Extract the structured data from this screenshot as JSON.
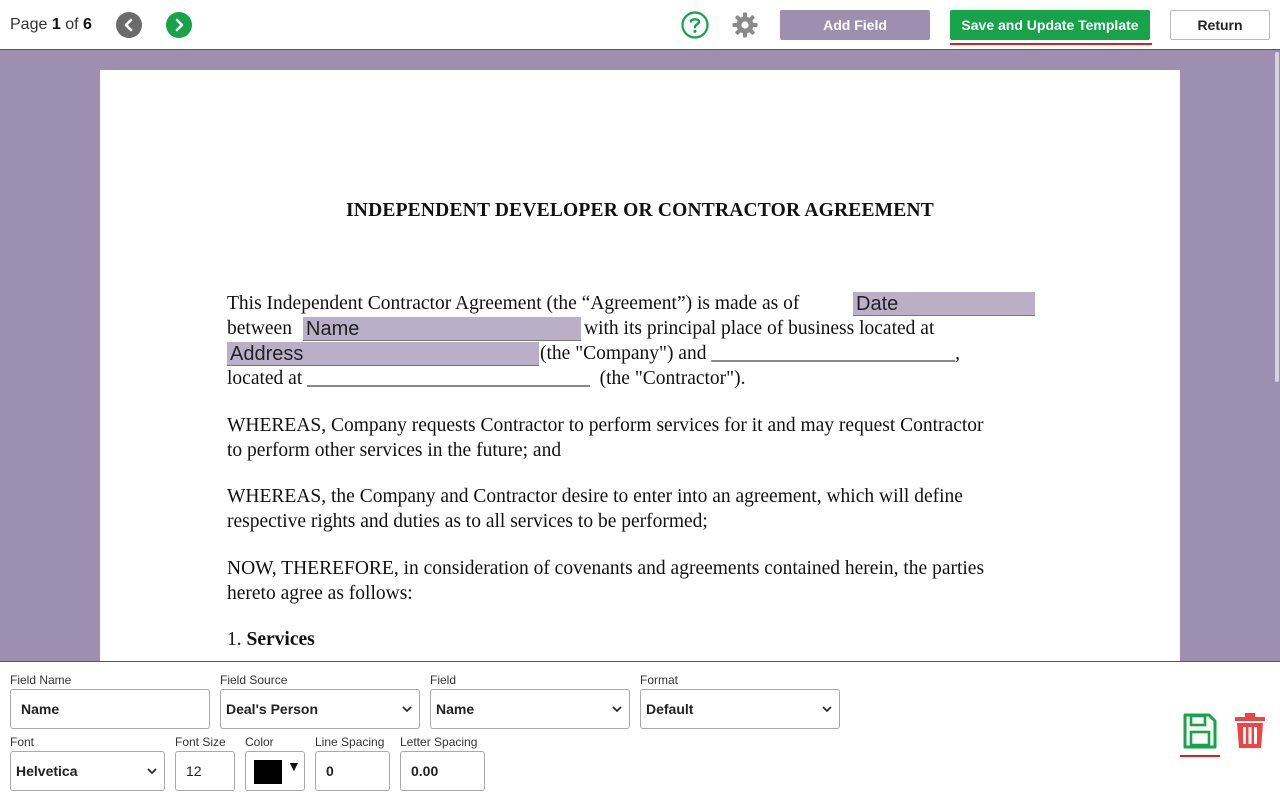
{
  "toolbar": {
    "page_prefix": "Page",
    "page_current": "1",
    "page_of": "of",
    "page_total": "6",
    "add_field_label": "Add Field",
    "save_label": "Save and Update Template",
    "return_label": "Return",
    "icons": [
      "chevron-left-icon",
      "chevron-right-icon",
      "help-icon",
      "gear-icon"
    ]
  },
  "document": {
    "title": "INDEPENDENT DEVELOPER OR CONTRACTOR AGREEMENT",
    "lines": [
      "This Independent Contractor Agreement (the “Agreement”) is made as of",
      "between",
      "with its principal place of business located at",
      "(the \"Company\") and _________________________,",
      "located at _____________________________  (the \"Contractor\").",
      "WHEREAS, Company requests Contractor to perform services for it and may request Contractor",
      "to perform other services in the future; and",
      "WHEREAS, the Company and Contractor desire to enter into an agreement, which will define",
      "respective rights and duties as to all services to be performed;",
      "NOW, THEREFORE, in consideration of covenants and agreements contained herein, the parties",
      "hereto agree as follows:",
      "1."
    ],
    "section_title": "Services",
    "fields": {
      "date": "Date",
      "name": "Name",
      "address": "Address"
    }
  },
  "panel": {
    "field_name_label": "Field Name",
    "field_name_value": "Name",
    "field_source_label": "Field Source",
    "field_source_value": "Deal's Person",
    "field_label": "Field",
    "field_value": "Name",
    "format_label": "Format",
    "format_value": "Default",
    "font_label": "Font",
    "font_value": "Helvetica",
    "font_size_label": "Font Size",
    "font_size_value": "12",
    "color_label": "Color",
    "color_value": "#000000",
    "line_spacing_label": "Line Spacing",
    "line_spacing_value": "0",
    "letter_spacing_label": "Letter Spacing",
    "letter_spacing_value": "0.00"
  },
  "colors": {
    "accent_green": "#16a34a",
    "workspace_bg": "#9d8fb0",
    "field_highlight": "#b9b0c8",
    "danger_red": "#e11d1d"
  }
}
